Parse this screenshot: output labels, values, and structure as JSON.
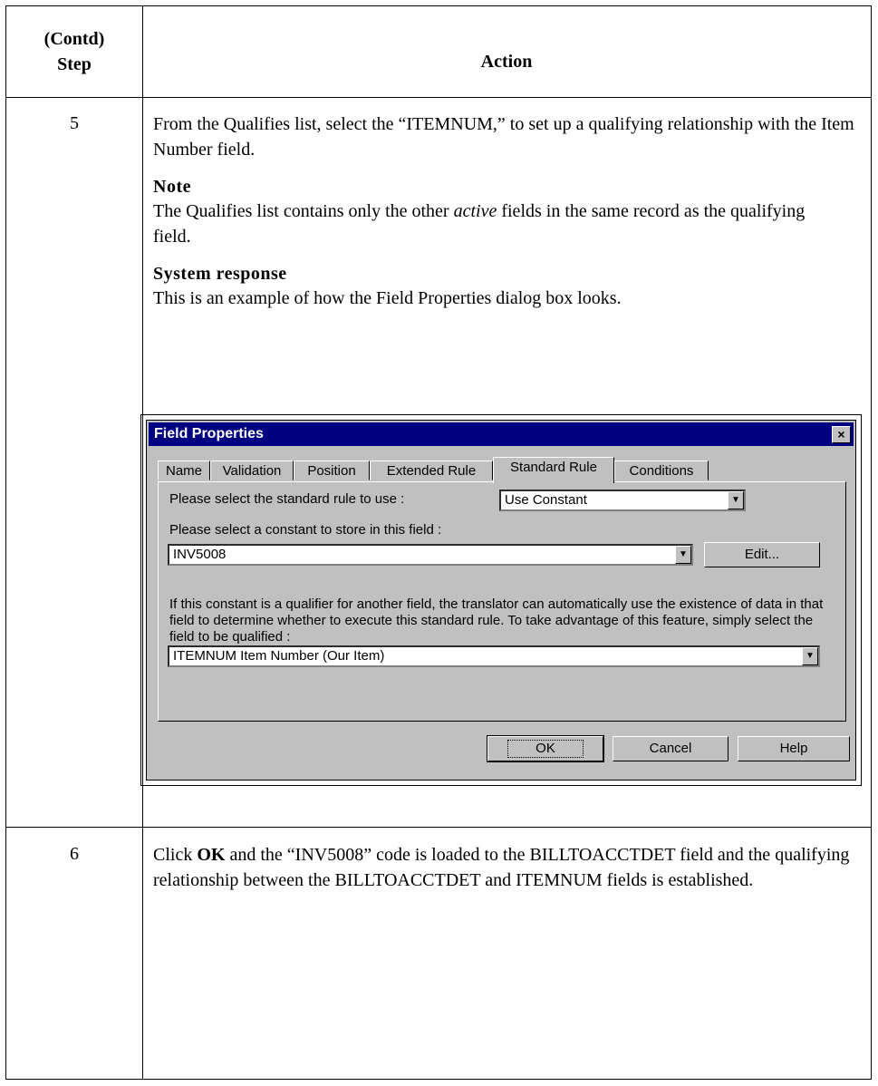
{
  "table": {
    "header_step": "(Contd)\nStep",
    "header_step_line1": "(Contd)",
    "header_step_line2": "Step",
    "header_action": "Action"
  },
  "step5": {
    "number": "5",
    "text": "From the Qualifies list, select the “ITEMNUM,” to set up a qualifying relationship with the Item Number field.",
    "note_heading": "Note",
    "note_text_before": "The Qualifies list contains only the other ",
    "note_text_em": "active",
    "note_text_after": " fields in the same record as the qualifying field.",
    "response_heading": "System response",
    "response_text": "This is an example of how the Field Properties dialog box looks."
  },
  "dialog": {
    "title": "Field Properties",
    "close_glyph": "×",
    "tabs": [
      "Name",
      "Validation",
      "Position",
      "Extended Rule",
      "Standard Rule",
      "Conditions"
    ],
    "active_tab": "Standard Rule",
    "rule_label": "Please select the standard rule to use :",
    "rule_value": "Use Constant",
    "constant_label": "Please select a constant to store in this field :",
    "constant_value": "INV5008",
    "edit_button": "Edit...",
    "qualifier_text": "If this constant is a qualifier for another field, the translator can automatically use the existence of data in that field to determine whether to execute this standard rule. To take advantage of this feature, simply select the field to be qualified :",
    "qualified_value": "ITEMNUM Item Number (Our Item)",
    "ok_button": "OK",
    "cancel_button": "Cancel",
    "help_button": "Help",
    "dropdown_glyph": "▼"
  },
  "step6": {
    "number": "6",
    "text_prefix": "Click ",
    "text_bold": "OK",
    "text_rest": " and the “INV5008” code is loaded to the BILLTOACCTDET field and the qualifying relationship between the BILLTOACCTDET and ITEMNUM fields is established."
  }
}
